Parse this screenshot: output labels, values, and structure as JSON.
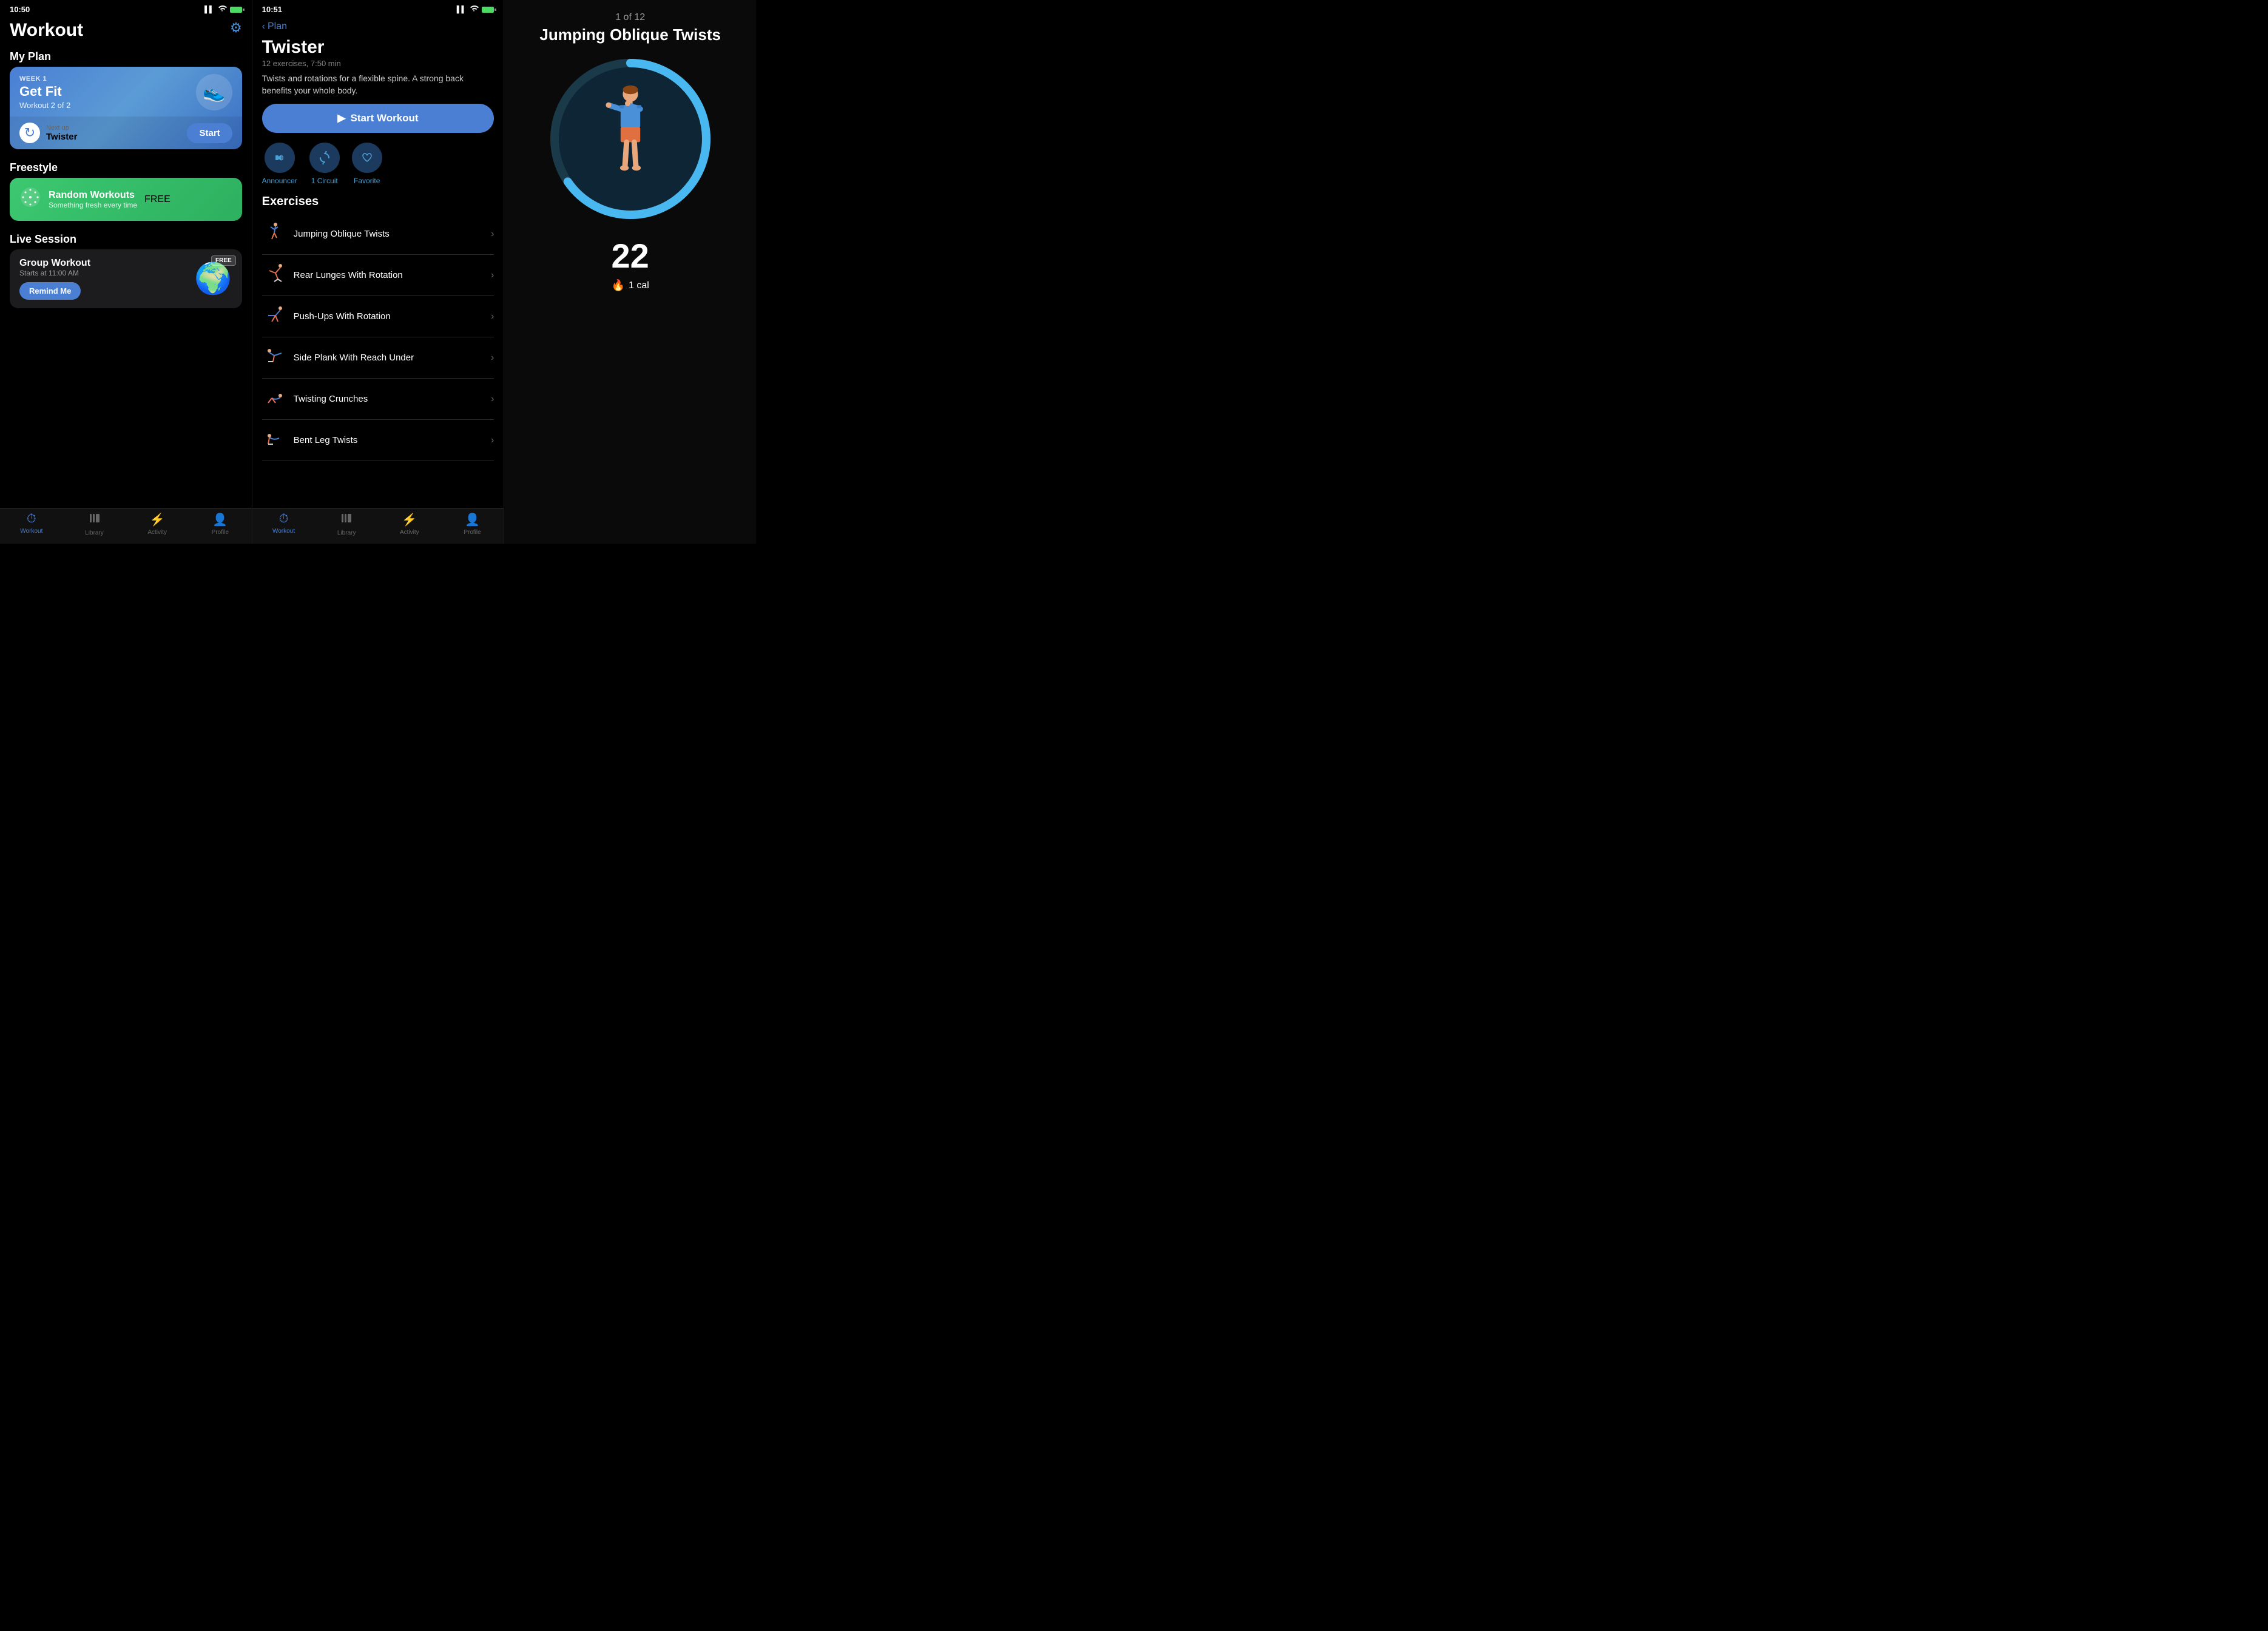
{
  "panel1": {
    "status": {
      "time": "10:50",
      "location": "▶",
      "signal": "▌▌▌",
      "wifi": "WiFi",
      "battery": "Battery"
    },
    "title": "Workout",
    "gear_label": "Settings",
    "my_plan_label": "My Plan",
    "plan_card": {
      "week_label": "WEEK 1",
      "name": "Get Fit",
      "subtitle": "Workout 2 of 2",
      "shoe_emoji": "👟",
      "next_label": "Next up",
      "next_name": "Twister",
      "start_label": "Start"
    },
    "freestyle_label": "Freestyle",
    "freestyle_card": {
      "name": "Random Workouts",
      "subtitle": "Something fresh every time",
      "badge": "FREE",
      "icon": "✦"
    },
    "live_label": "Live Session",
    "live_card": {
      "name": "Group Workout",
      "time": "Starts at 11:00 AM",
      "badge": "FREE",
      "remind_label": "Remind Me",
      "globe_emoji": "🌍"
    },
    "tab_bar": {
      "items": [
        {
          "icon": "⏱",
          "label": "Workout",
          "active": true
        },
        {
          "icon": "|||",
          "label": "Library",
          "active": false
        },
        {
          "icon": "⚡",
          "label": "Activity",
          "active": false
        },
        {
          "icon": "👤",
          "label": "Profile",
          "active": false
        }
      ]
    }
  },
  "panel2": {
    "status": {
      "time": "10:51",
      "location": "▶"
    },
    "back_label": "Plan",
    "workout_title": "Twister",
    "meta": "12 exercises, 7:50 min",
    "description": "Twists and rotations for a flexible spine. A strong back benefits your whole body.",
    "start_label": "Start Workout",
    "options": [
      {
        "label": "Announcer",
        "icon": "🎙"
      },
      {
        "label": "1 Circuit",
        "icon": "↻"
      },
      {
        "label": "Favorite",
        "icon": "♡"
      }
    ],
    "exercises_title": "Exercises",
    "exercises": [
      {
        "name": "Jumping Oblique Twists",
        "figure": "🏃"
      },
      {
        "name": "Rear Lunges With Rotation",
        "figure": "🤸"
      },
      {
        "name": "Push-Ups With Rotation",
        "figure": "🤾"
      },
      {
        "name": "Side Plank With Reach Under",
        "figure": "🧘"
      },
      {
        "name": "Twisting Crunches",
        "figure": "🏋"
      },
      {
        "name": "Bent Leg Twists",
        "figure": "🤼"
      }
    ],
    "tab_bar": {
      "items": [
        {
          "icon": "⏱",
          "label": "Workout",
          "active": true
        },
        {
          "icon": "|||",
          "label": "Library",
          "active": false
        },
        {
          "icon": "⚡",
          "label": "Activity",
          "active": false
        },
        {
          "icon": "👤",
          "label": "Profile",
          "active": false
        }
      ]
    }
  },
  "panel3": {
    "counter": "1 of 12",
    "exercise_name": "Jumping Oblique Twists",
    "rep_count": "22",
    "cal_label": "1 cal",
    "colors": {
      "ring_bg": "#1a3a4a",
      "ring_progress": "#4ab8f0",
      "ring_inactive": "#0d2030"
    }
  }
}
